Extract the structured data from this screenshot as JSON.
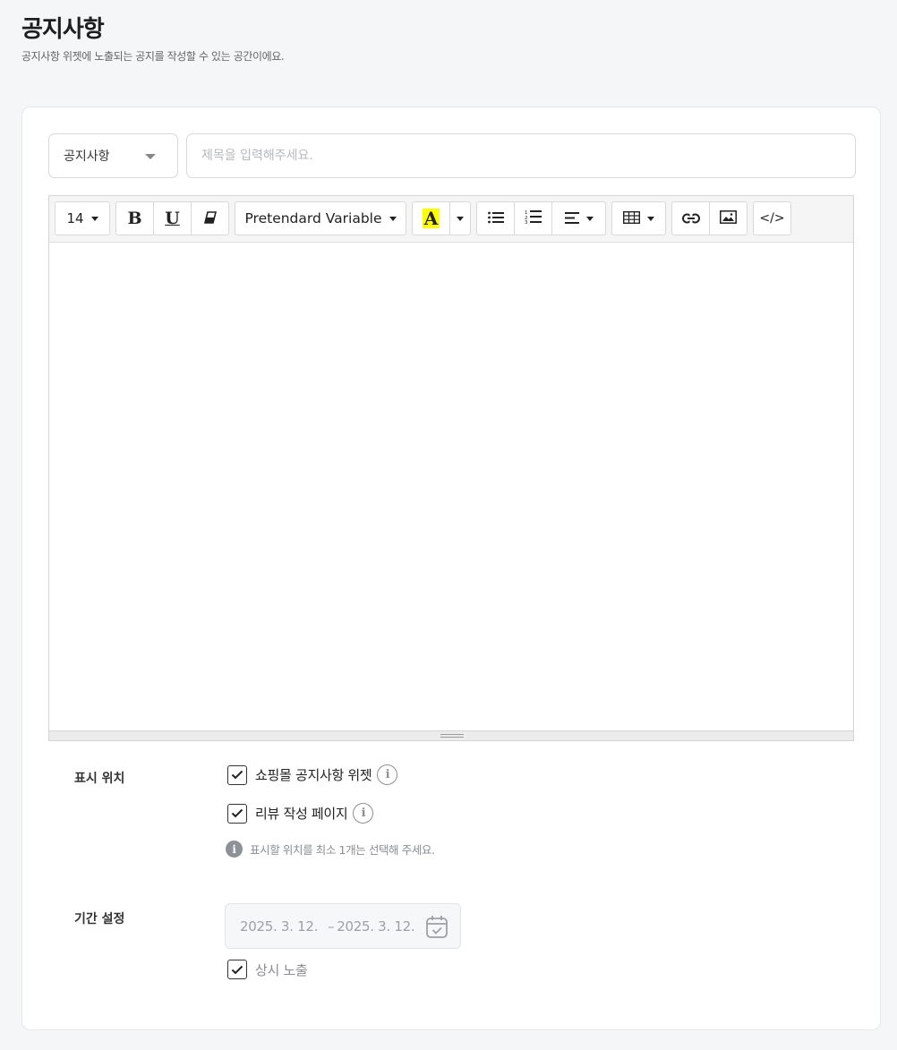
{
  "header": {
    "title": "공지사항",
    "subtitle": "공지사항 위젯에 노출되는 공지를 작성할 수 있는 공간이에요."
  },
  "form": {
    "category": "공지사항",
    "title_placeholder": "제목을 입력해주세요.",
    "title_value": ""
  },
  "toolbar": {
    "font_size": "14",
    "bold": "B",
    "underline": "U",
    "font_family": "Pretendard Variable",
    "color_letter": "A",
    "highlight_color": "#ffff00",
    "code_view": "</>",
    "icons": [
      "bold-icon",
      "underline-icon",
      "eraser-icon",
      "text-color-icon",
      "unordered-list-icon",
      "ordered-list-icon",
      "align-icon",
      "table-icon",
      "link-icon",
      "image-icon",
      "code-view-icon"
    ]
  },
  "display": {
    "label": "표시 위치",
    "options": [
      {
        "label": "쇼핑몰 공지사항 위젯",
        "checked": true
      },
      {
        "label": "리뷰 작성 페이지",
        "checked": true
      }
    ],
    "hint": "표시할 위치를 최소 1개는 선택해 주세요."
  },
  "period": {
    "label": "기간 설정",
    "start": "2025. 3. 12.",
    "separator": "–",
    "end": "2025. 3. 12.",
    "always_label": "상시 노출",
    "always_checked": true
  }
}
